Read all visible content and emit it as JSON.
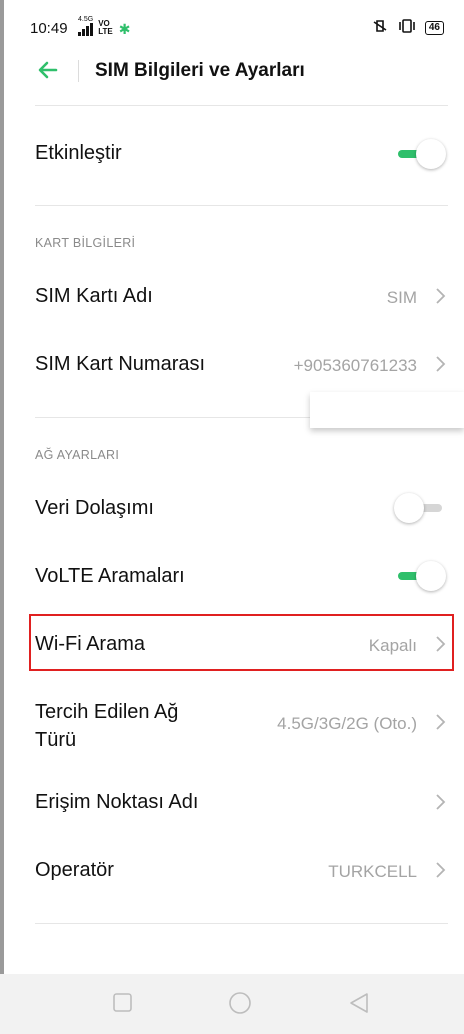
{
  "status_bar": {
    "time": "10:49",
    "network_type": "4.5G",
    "volte_top": "VO",
    "volte_bottom": "LTE",
    "battery": "46",
    "icons": [
      "signal-icon",
      "star-notification-icon",
      "vibrate-icon",
      "battery-icon"
    ]
  },
  "app_bar": {
    "title": "SIM Bilgileri ve Ayarları",
    "back_icon": "back-arrow-icon"
  },
  "colors": {
    "accent": "#2fbf6b",
    "highlight": "#e02020",
    "secondary_text": "#a4a4a4"
  },
  "settings": {
    "enable": {
      "label": "Etkinleştir",
      "toggle_on": true
    },
    "card_info": {
      "header": "KART BİLGİLERİ",
      "sim_name": {
        "label": "SIM Kartı Adı",
        "value": "SIM"
      },
      "sim_number": {
        "label": "SIM Kart Numarası",
        "value": "+905360761233"
      }
    },
    "network": {
      "header": "AĞ AYARLARI",
      "roaming": {
        "label": "Veri Dolaşımı",
        "toggle_on": false
      },
      "volte": {
        "label": "VoLTE Aramaları",
        "toggle_on": true
      },
      "wifi_calling": {
        "label": "Wi-Fi Arama",
        "value": "Kapalı"
      },
      "preferred_network": {
        "label_line1": "Tercih Edilen Ağ",
        "label_line2": "Türü",
        "value": "4.5G/3G/2G (Oto.)"
      },
      "apn": {
        "label": "Erişim Noktası Adı"
      },
      "operator": {
        "label": "Operatör",
        "value": "TURKCELL"
      }
    }
  },
  "nav_bar": {
    "icons": [
      "recents-square-icon",
      "home-circle-icon",
      "back-triangle-icon"
    ]
  }
}
